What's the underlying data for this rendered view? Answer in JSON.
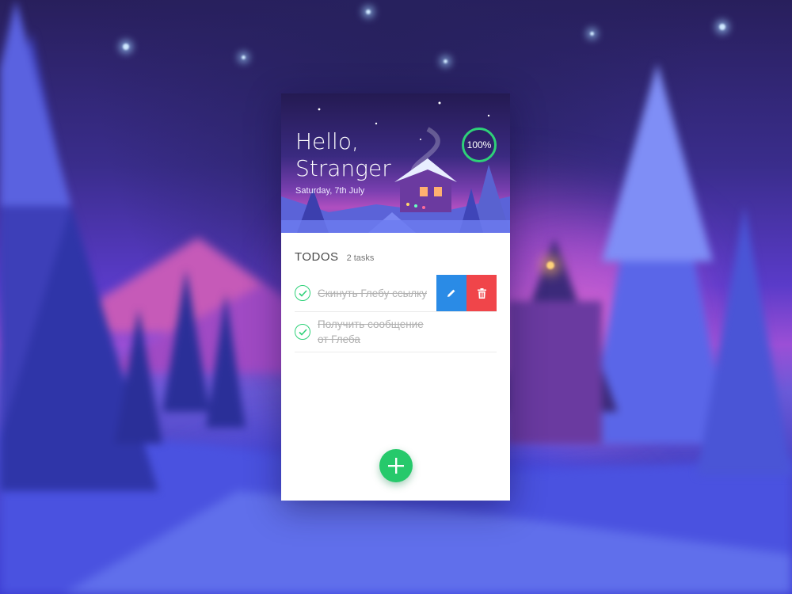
{
  "hero": {
    "greeting_line1": "Hello,",
    "greeting_line2": "Stranger",
    "date": "Saturday, 7th July",
    "progress": "100%"
  },
  "todos": {
    "title": "TODOS",
    "count": "2 tasks",
    "items": [
      {
        "text": "Скинуть Глебу ссылку",
        "done": true
      },
      {
        "text": "Получить сообщение от Глеба",
        "done": true
      }
    ]
  },
  "icons": {
    "edit": "pencil-icon",
    "delete": "trash-icon",
    "check": "check-icon",
    "add": "plus-icon"
  },
  "colors": {
    "accent_green": "#2ed178",
    "edit_blue": "#2a8be6",
    "delete_red": "#f0454a",
    "fab_green": "#26c96b"
  }
}
